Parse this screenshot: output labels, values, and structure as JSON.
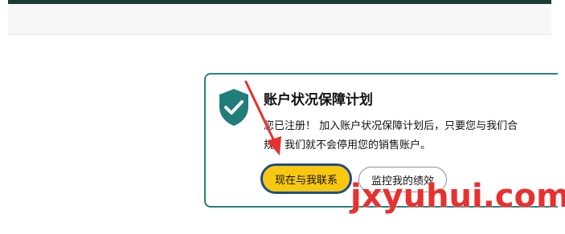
{
  "card": {
    "title": "账户状况保障计划",
    "desc_line1": "您已注册！ 加入账户状况保障计划后，只要您与我们合",
    "desc_line2": "规，我们就不会停用您的销售账户。",
    "primary_button": "现在与我联系",
    "secondary_button": "监控我的绩效"
  },
  "watermark": "jxyuhui.com",
  "colors": {
    "accent_border": "#2b7f7c",
    "primary_button_bg": "#f7c80f",
    "primary_button_border": "#1f4b8a",
    "annotation_arrow": "#e8312f",
    "top_bar": "#1d3b36"
  },
  "icons": {
    "shield": "shield-check-icon",
    "annotation": "red-arrow-annotation"
  }
}
